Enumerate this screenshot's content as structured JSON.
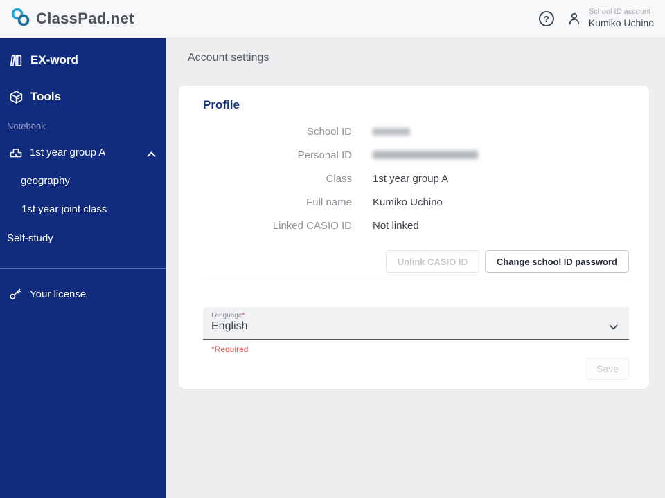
{
  "colors": {
    "sidebar_bg": "#112b7e",
    "accent_blue": "#16337f",
    "required_red": "#d94f4f",
    "logo_light_blue": "#2ba3d9",
    "logo_dark_blue": "#1d6f9b"
  },
  "header": {
    "logo_text": "ClassPad.net",
    "help_glyph": "?",
    "account_type": "School ID account",
    "account_name": "Kumiko Uchino"
  },
  "sidebar": {
    "ex_word": "EX-word",
    "tools": "Tools",
    "section_label": "Notebook",
    "group": "1st year group A",
    "group_children": [
      "geography",
      "1st year joint class"
    ],
    "self_study": "Self-study",
    "license": "Your license"
  },
  "main": {
    "page_title": "Account settings",
    "profile": {
      "title": "Profile",
      "rows": [
        {
          "label": "School ID",
          "value": "",
          "redacted": true
        },
        {
          "label": "Personal ID",
          "value": "",
          "redacted": true
        },
        {
          "label": "Class",
          "value": "1st year group A",
          "redacted": false
        },
        {
          "label": "Full name",
          "value": "Kumiko Uchino",
          "redacted": false
        },
        {
          "label": "Linked CASIO ID",
          "value": "Not linked",
          "redacted": false
        }
      ],
      "unlink_button": "Unlink CASIO ID",
      "change_password_button": "Change school ID password"
    },
    "language_field": {
      "label": "Language",
      "required_asterisk": "*",
      "value": "English"
    },
    "required_note": "*Required",
    "save_button": "Save"
  }
}
